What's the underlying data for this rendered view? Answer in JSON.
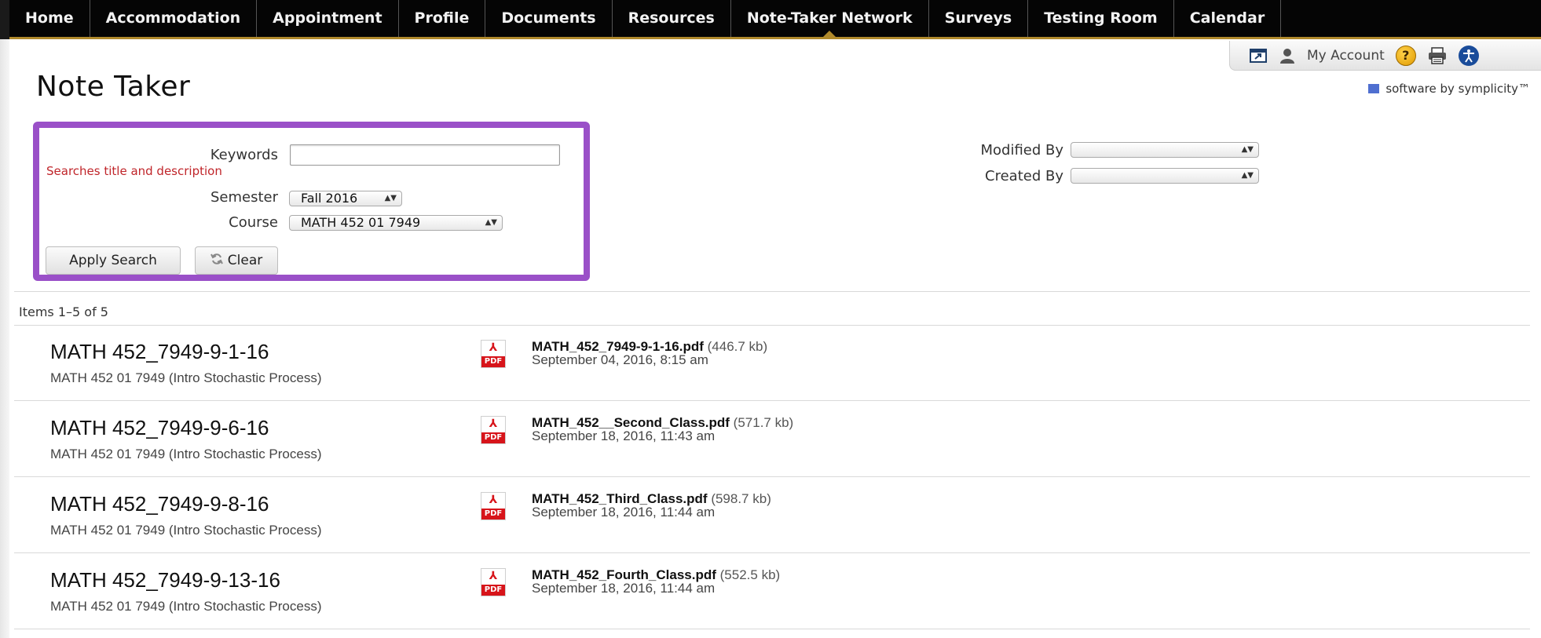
{
  "nav": {
    "items": [
      "Home",
      "Accommodation",
      "Appointment",
      "Profile",
      "Documents",
      "Resources",
      "Note-Taker Network",
      "Surveys",
      "Testing Room",
      "Calendar"
    ],
    "active": "Note-Taker Network"
  },
  "account": {
    "label": "My Account"
  },
  "branding": {
    "text": "software by symplicity™"
  },
  "page": {
    "title": "Note Taker"
  },
  "search": {
    "keywords_label": "Keywords",
    "keywords_value": "",
    "keywords_hint": "Searches title and description",
    "semester_label": "Semester",
    "semester_value": "Fall 2016",
    "course_label": "Course",
    "course_value": "MATH 452 01 7949",
    "modified_by_label": "Modified By",
    "modified_by_value": "",
    "created_by_label": "Created By",
    "created_by_value": "",
    "apply_label": "Apply Search",
    "clear_label": "Clear"
  },
  "results": {
    "count_text": "Items 1–5 of 5",
    "items": [
      {
        "title": "MATH 452_7949-9-1-16",
        "course": "MATH 452 01 7949 (Intro Stochastic Process)",
        "file": "MATH_452_7949-9-1-16.pdf",
        "size": "(446.7 kb)",
        "date": "September 04, 2016, 8:15 am"
      },
      {
        "title": "MATH 452_7949-9-6-16",
        "course": "MATH 452 01 7949 (Intro Stochastic Process)",
        "file": "MATH_452__Second_Class.pdf",
        "size": "(571.7 kb)",
        "date": "September 18, 2016, 11:43 am"
      },
      {
        "title": "MATH 452_7949-9-8-16",
        "course": "MATH 452 01 7949 (Intro Stochastic Process)",
        "file": "MATH_452_Third_Class.pdf",
        "size": "(598.7 kb)",
        "date": "September 18, 2016, 11:44 am"
      },
      {
        "title": "MATH 452_7949-9-13-16",
        "course": "MATH 452 01 7949 (Intro Stochastic Process)",
        "file": "MATH_452_Fourth_Class.pdf",
        "size": "(552.5 kb)",
        "date": "September 18, 2016, 11:44 am"
      }
    ]
  },
  "colors": {
    "nav_bg": "#050505",
    "nav_border": "#b08a2c",
    "highlight_border": "#9a50c8",
    "hint": "#c0252a",
    "pdf_red": "#d7141a"
  },
  "icons": [
    "popout-icon",
    "user-icon",
    "help-icon",
    "print-icon",
    "accessibility-icon",
    "refresh-icon",
    "pdf-icon"
  ]
}
